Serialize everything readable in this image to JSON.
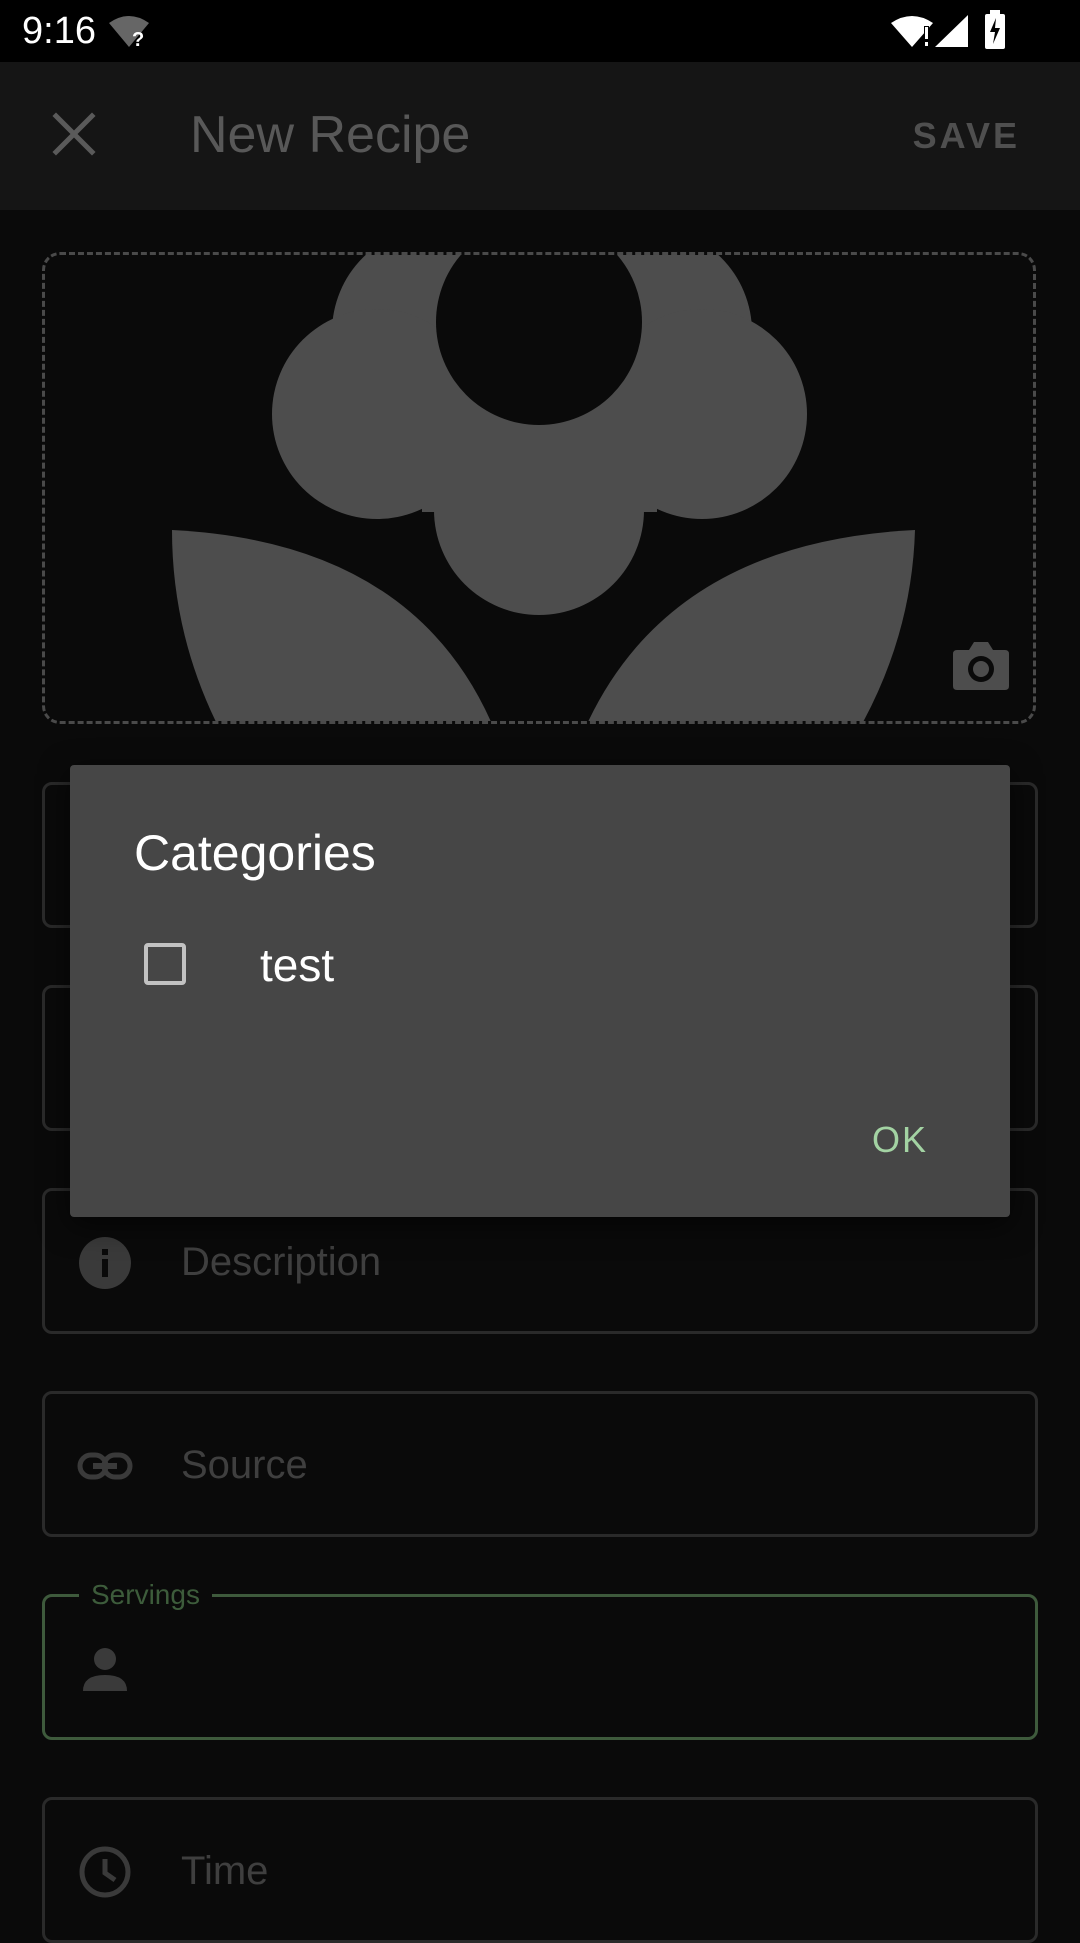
{
  "status_bar": {
    "time": "9:16"
  },
  "app_bar": {
    "title": "New Recipe",
    "save_label": "SAVE"
  },
  "form": {
    "description_placeholder": "Description",
    "source_placeholder": "Source",
    "servings_label": "Servings",
    "time_placeholder": "Time"
  },
  "dialog": {
    "title": "Categories",
    "items": [
      {
        "label": "test",
        "checked": false
      }
    ],
    "ok_label": "OK"
  },
  "colors": {
    "accent": "#a3d3a3",
    "dialog_bg": "#464646",
    "background": "#0a0a0a"
  },
  "icons": {
    "close": "close-icon",
    "camera": "camera-icon",
    "description": "info-icon",
    "source": "link-icon",
    "servings": "person-icon",
    "time": "clock-icon"
  }
}
